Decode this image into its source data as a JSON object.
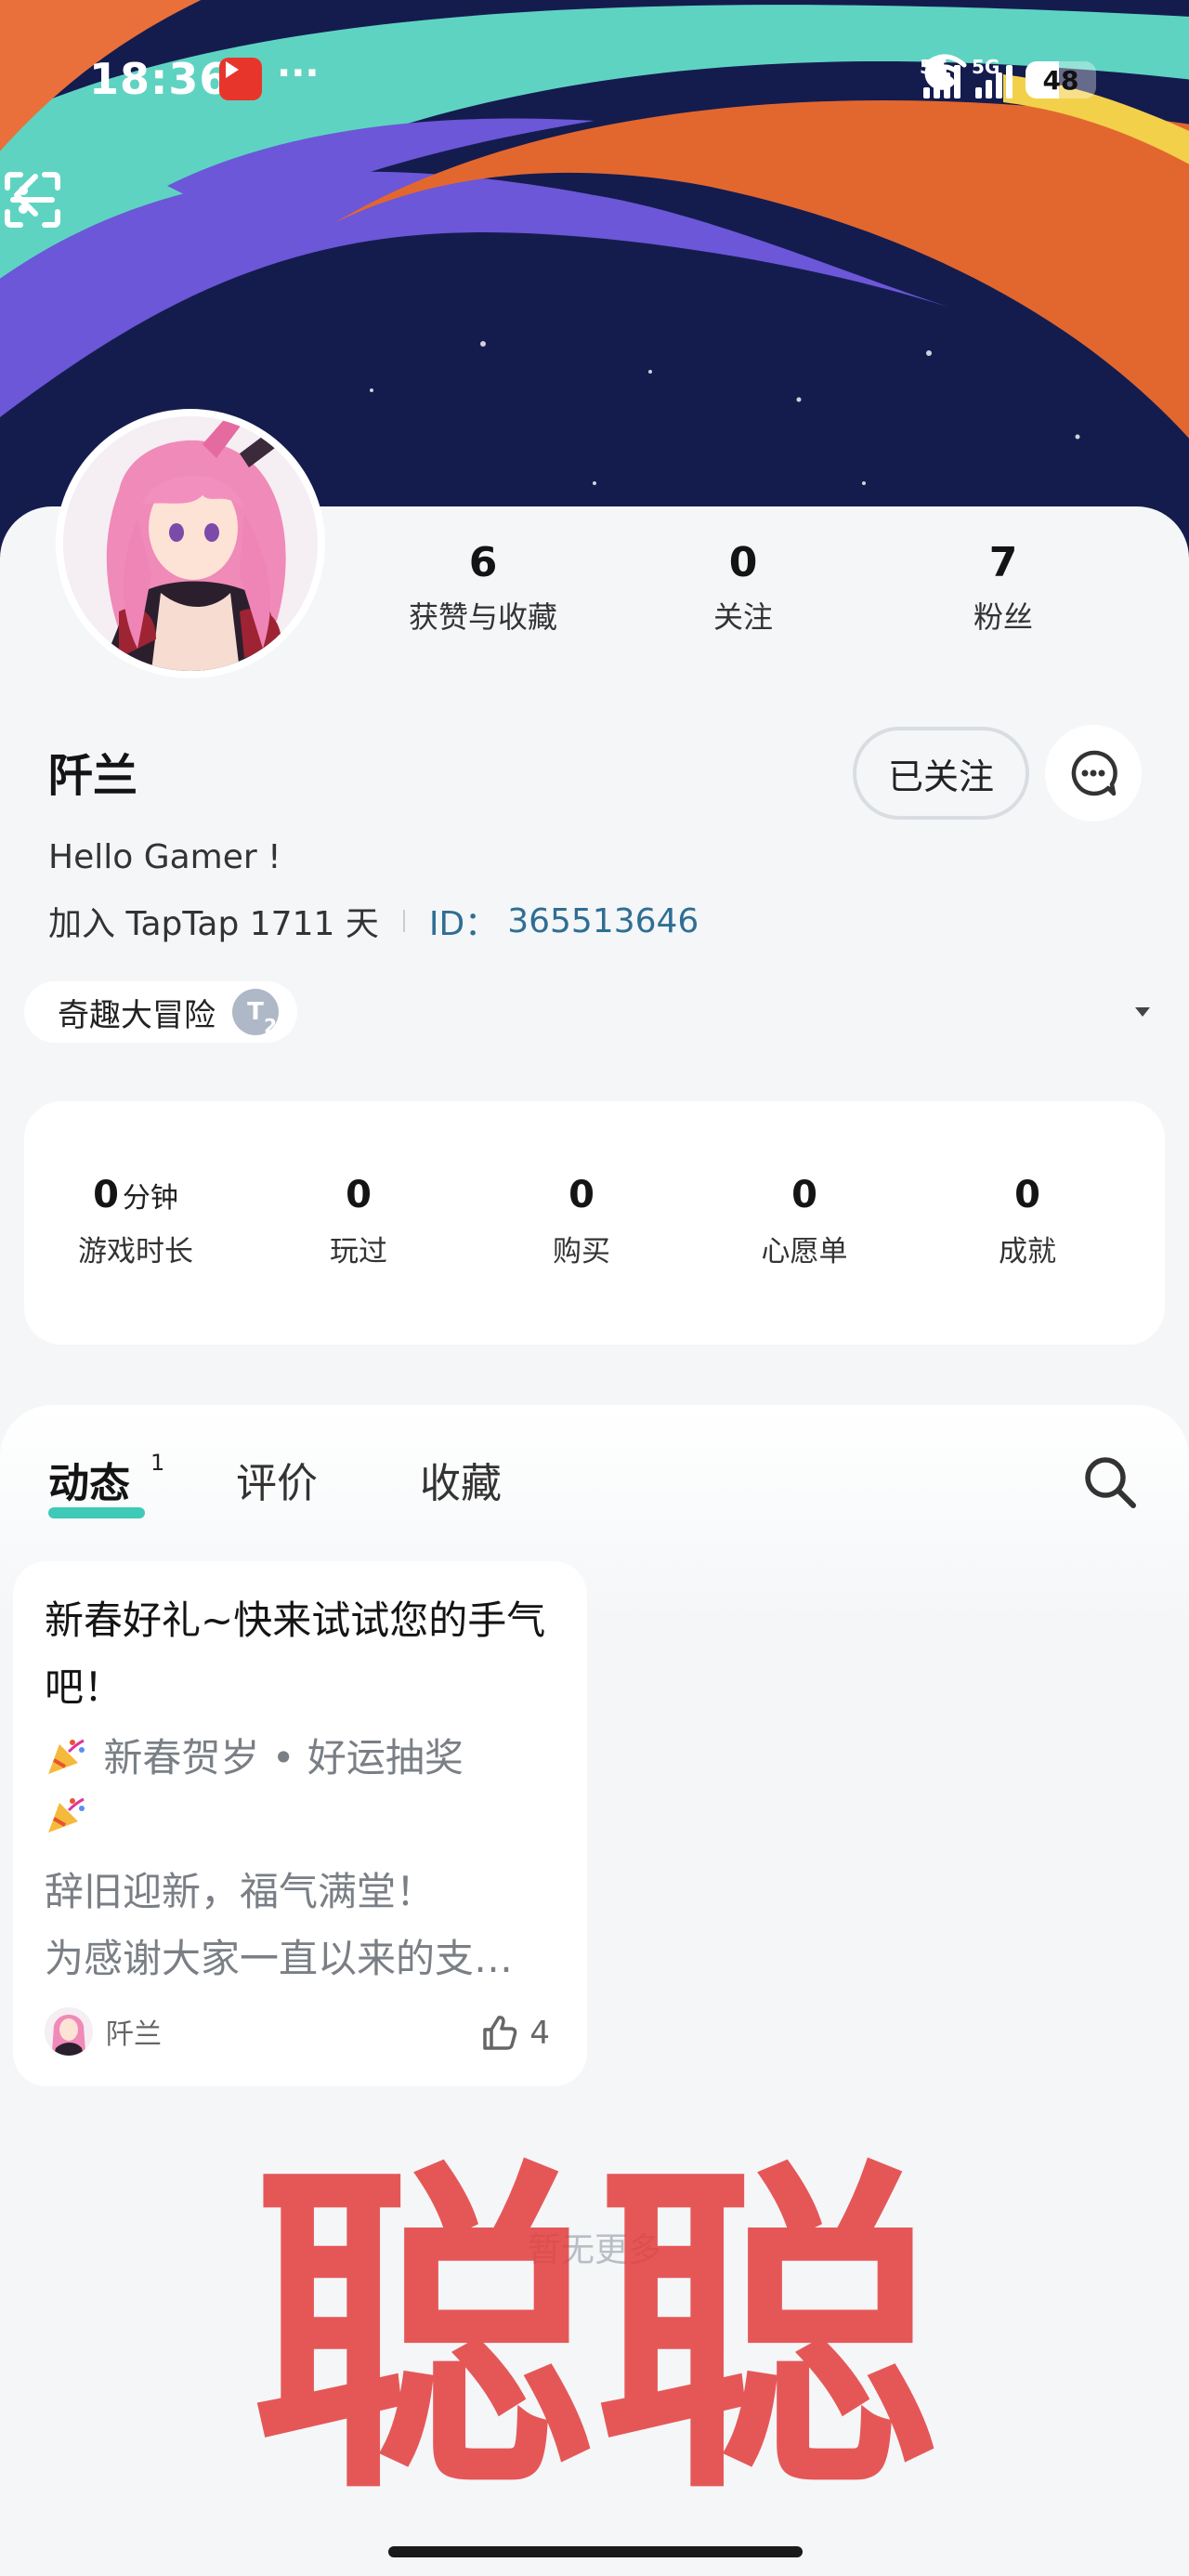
{
  "status_bar": {
    "time": "18:36",
    "more_indicator": "···",
    "signal_1_label": "5G",
    "signal_2_label": "5G",
    "battery": "48"
  },
  "header": {
    "back_icon": "chevron-left-icon",
    "scan_icon": "scan-icon",
    "more_icon": "vertical-dots-icon"
  },
  "profile": {
    "stats": [
      {
        "value": "6",
        "label": "获赞与收藏"
      },
      {
        "value": "0",
        "label": "关注"
      },
      {
        "value": "7",
        "label": "粉丝"
      }
    ],
    "name": "阡兰",
    "follow_label": "已关注",
    "bio": "Hello Gamer !",
    "joined": "加入 TapTap 1711 天",
    "id_label": "ID：",
    "id_value": "365513646",
    "tag": "奇趣大冒险",
    "tag_badge": "T",
    "tag_badge_sub": "2"
  },
  "game_stats": [
    {
      "value": "0",
      "unit": "分钟",
      "label": "游戏时长"
    },
    {
      "value": "0",
      "unit": "",
      "label": "玩过"
    },
    {
      "value": "0",
      "unit": "",
      "label": "购买"
    },
    {
      "value": "0",
      "unit": "",
      "label": "心愿单"
    },
    {
      "value": "0",
      "unit": "",
      "label": "成就"
    }
  ],
  "tabs": {
    "items": [
      "动态",
      "评价",
      "收藏"
    ],
    "active_count": "1"
  },
  "post": {
    "title": "新春好礼~快来试试您的手气吧！",
    "line1": "新春贺岁 • 好运抽奖",
    "line3": "辞旧迎新，福气满堂！",
    "line4": "为感谢大家一直以来的支…",
    "author": "阡兰",
    "likes": "4"
  },
  "footer": {
    "no_more": "暂无更多",
    "watermark": "聪聪"
  },
  "colors": {
    "accent": "#3fc9b7",
    "id_blue": "#2f6e94",
    "watermark_red": "#e23b3b"
  }
}
